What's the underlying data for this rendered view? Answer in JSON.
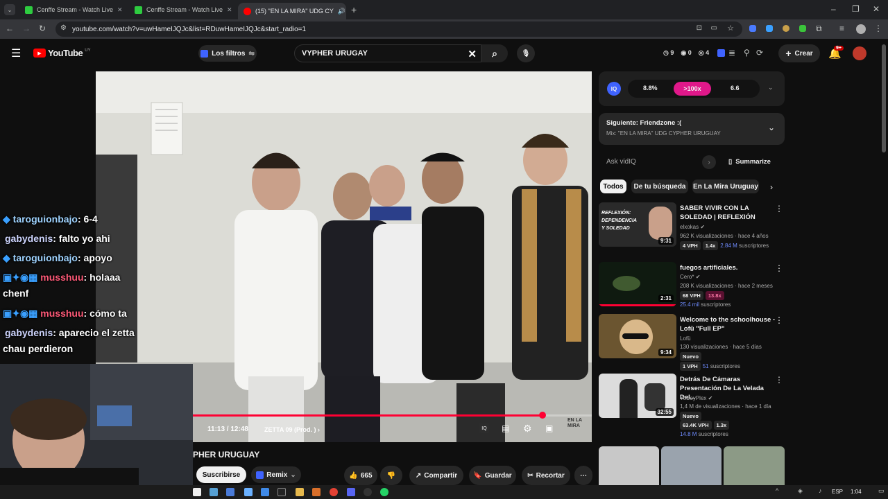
{
  "tabs": [
    {
      "label": "Cenffe Stream - Watch Live",
      "color": "#2ecc40"
    },
    {
      "label": "Cenffe Stream - Watch Live",
      "color": "#2ecc40"
    },
    {
      "label": "(15) \"EN LA MIRA\" UDG CY",
      "color": "#ff0000"
    }
  ],
  "browser": {
    "url": "youtube.com/watch?v=uwHameIJQJc&list=RDuwHameIJQJc&start_radio=1"
  },
  "header": {
    "logo": "YouTube",
    "logo_region": "UY",
    "filters_label": "Los filtros",
    "search_value": "VYPHER URUGAY",
    "stats": [
      "9",
      "0",
      "4"
    ],
    "create_label": "Crear",
    "notif_count": "9+"
  },
  "player": {
    "time": "11:13 / 12:48",
    "chapter": "ZETTA 09 (Prod. )",
    "progress": 0.876,
    "watermark": "EN LA MIRA"
  },
  "chat": [
    {
      "user": "taroguionbajo",
      "msg": ": 6-4",
      "style": "blue"
    },
    {
      "user": "gabydenis",
      "msg": ": falto yo ahi",
      "style": "plain"
    },
    {
      "user": "taroguionbajo",
      "msg": ": apoyo",
      "style": "blue"
    },
    {
      "user": "musshuu",
      "msg": ": holaaa",
      "msg2": "chenf",
      "style": "red"
    },
    {
      "user": "musshuu",
      "msg": ": cómo ta",
      "style": "red"
    },
    {
      "user": "gabydenis",
      "msg": ": aparecio el zetta",
      "msg2": "chau perdieron",
      "style": "plain"
    }
  ],
  "below": {
    "title": "PHER URUGUAY",
    "subscribe": "Suscribirse",
    "remix": "Remix",
    "likes": "665",
    "share": "Compartir",
    "save": "Guardar",
    "clip": "Recortar"
  },
  "vidiq": {
    "score1": "8.8%",
    "score2": ">100x",
    "score3": "6.6",
    "ask": "Ask vidIQ",
    "summarize": "Summarize"
  },
  "next": {
    "label": "Siguiente: Friendzone :(",
    "sub": "Mix: \"EN LA MIRA\" UDG CYPHER URUGUAY"
  },
  "chips": [
    "Todos",
    "De tu búsqueda",
    "En La Mira Uruguay"
  ],
  "recs": [
    {
      "title": "SABER VIVIR CON LA SOLEDAD | REFLEXIÓN",
      "channel": "elxokas",
      "views": "962 K visualizaciones · hace 4 años",
      "duration": "9:31",
      "vph": "4 VPH",
      "mult": "1.4x",
      "subs": "2.84 M",
      "subs_label": "suscriptores",
      "thumb_text": "REFLEXIÓN: DEPENDENCIA Y SOLEDAD"
    },
    {
      "title": "fuegos artificiales.",
      "channel": "Cero*",
      "views": "208 K visualizaciones · hace 2 meses",
      "duration": "2:31",
      "vph": "68 VPH",
      "mult": "13.8x",
      "subs": "25.4 mil",
      "subs_label": "suscriptores"
    },
    {
      "title": "Welcome to the schoolhouse - Lofü \"Full EP\"",
      "channel": "Lofü",
      "views": "130 visualizaciones · hace 5 días",
      "duration": "9:34",
      "tag": "Nuevo",
      "vph": "1 VPH",
      "subs": "51",
      "subs_label": "suscriptores"
    },
    {
      "title": "Detrás De Cámaras Presentación De La Velada Del...",
      "channel": "YoSoyPlex",
      "views": "1,4 M de visualizaciones · hace 1 día",
      "duration": "32:55",
      "tag": "Nuevo",
      "vph": "63.4K VPH",
      "mult": "1.3x",
      "subs": "14.8 M",
      "subs_label": "suscriptores"
    }
  ],
  "taskbar": {
    "lang": "ESP",
    "time": "1:04"
  }
}
